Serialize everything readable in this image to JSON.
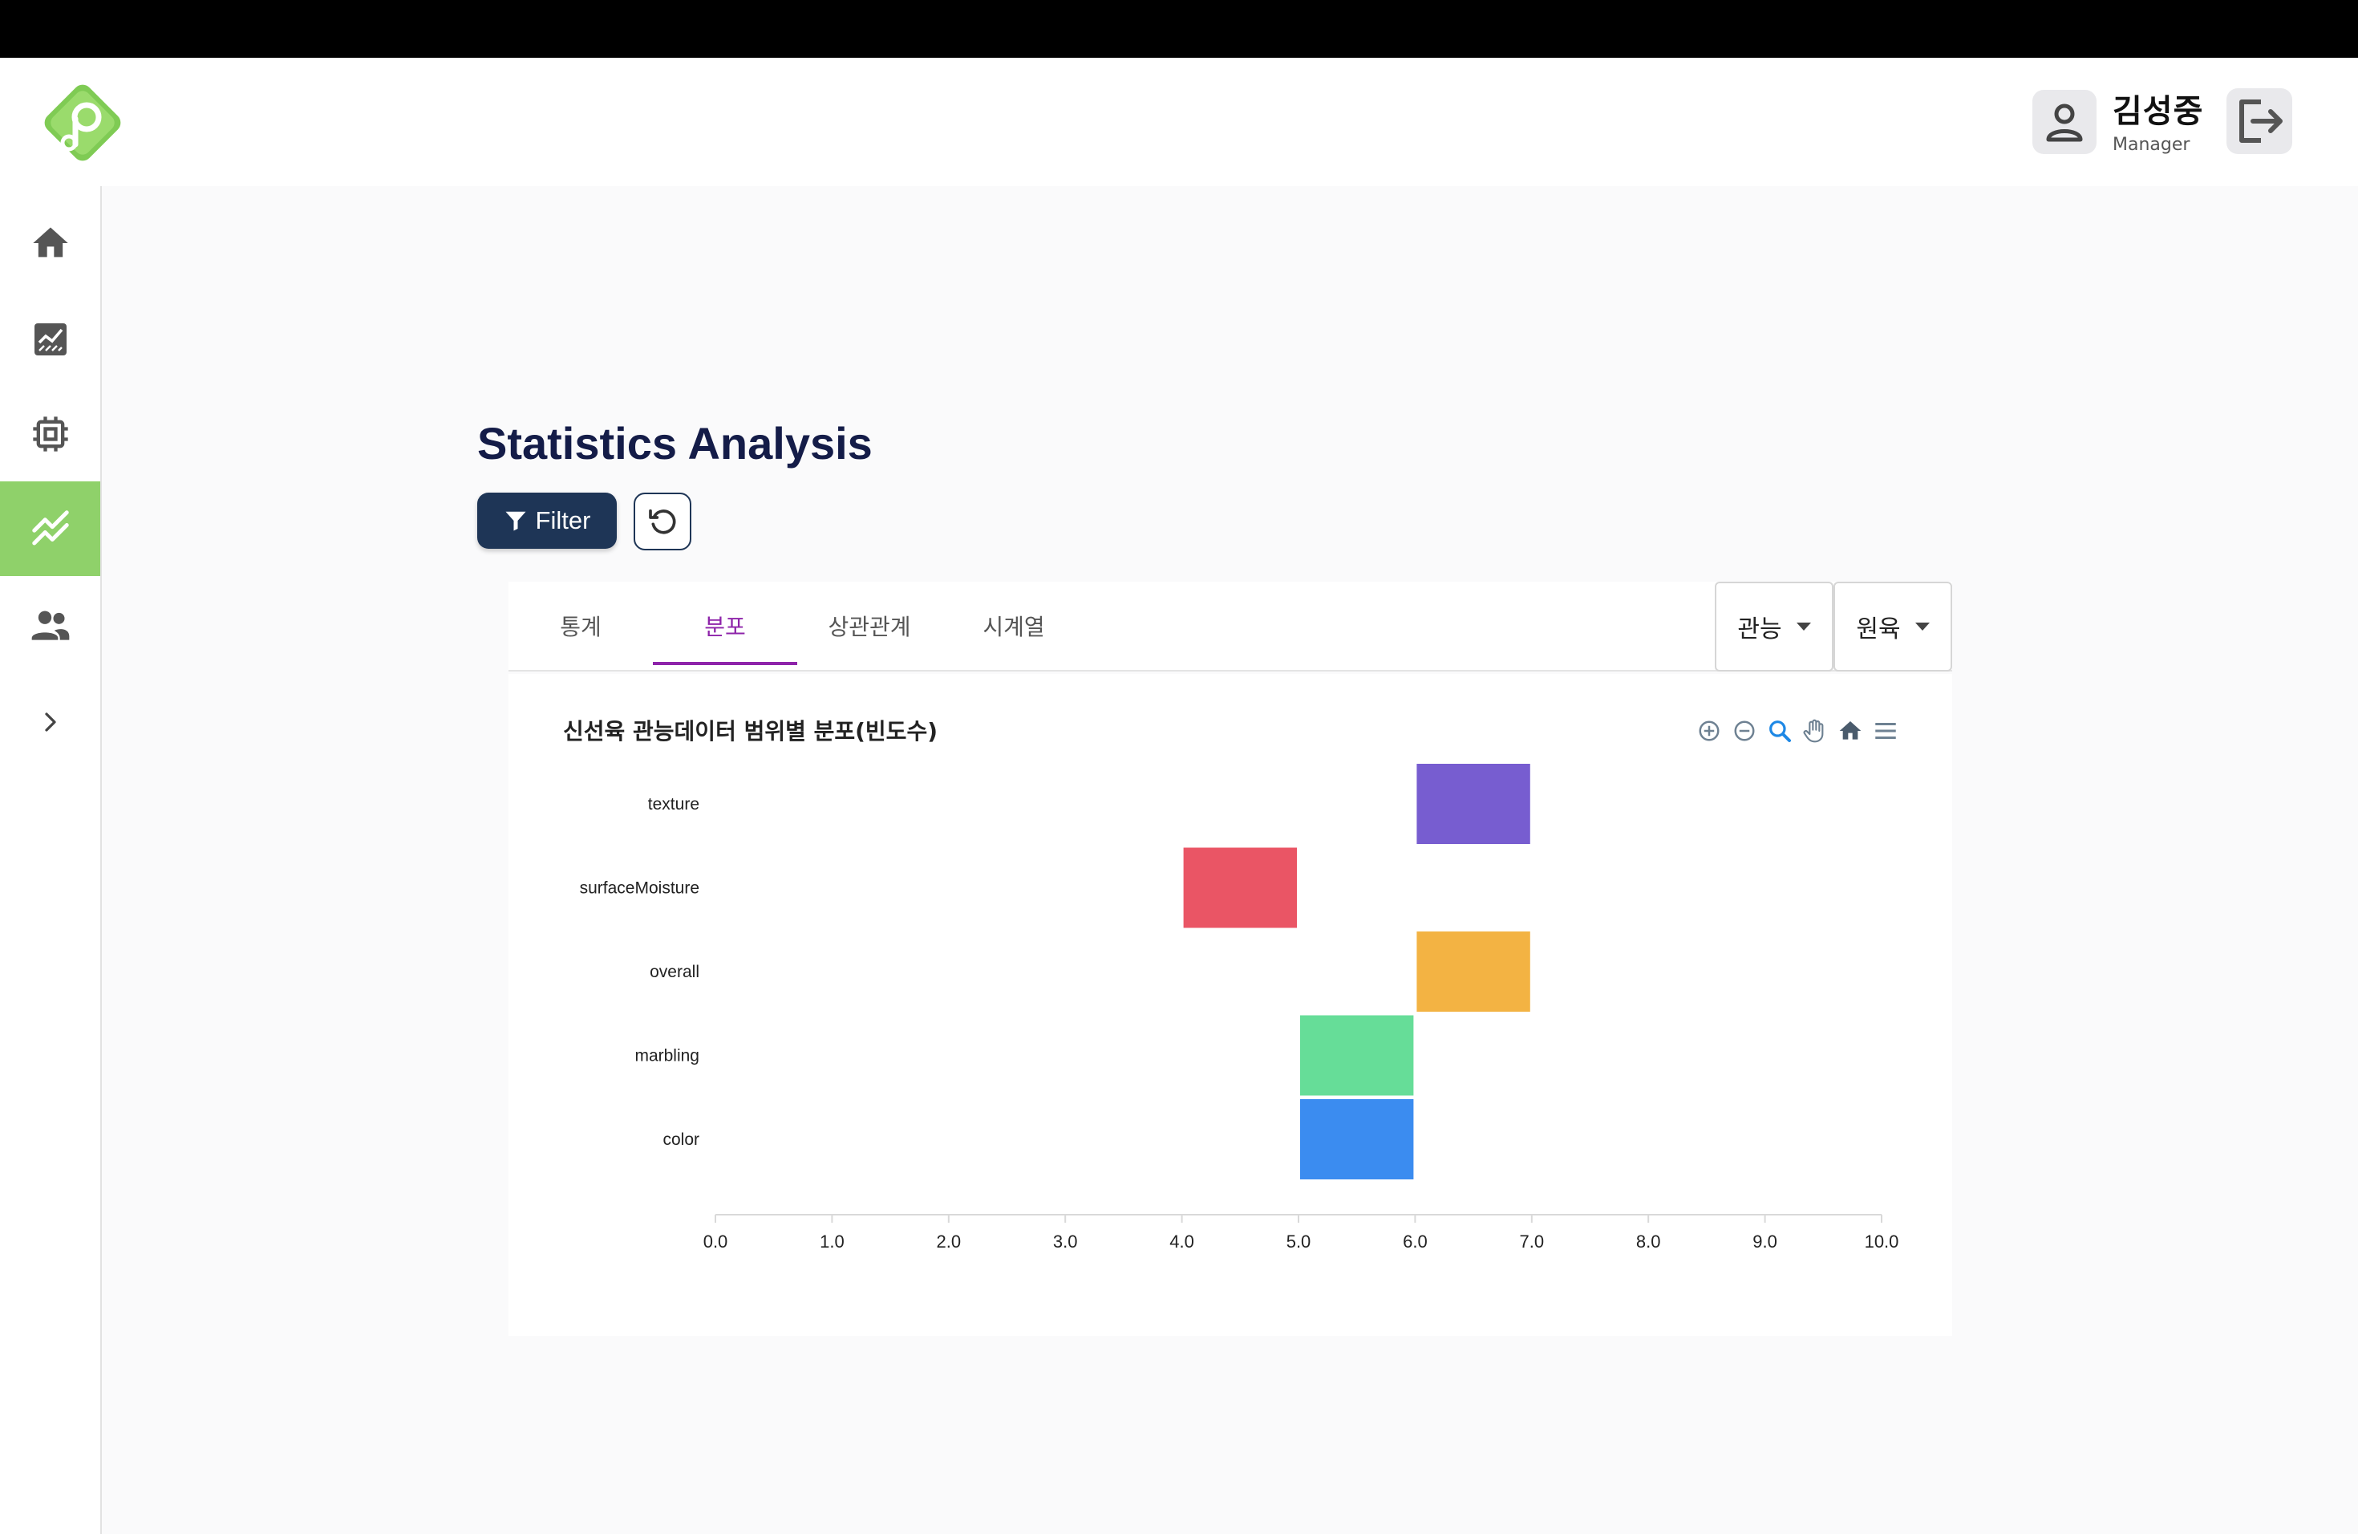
{
  "user": {
    "name": "김성중",
    "role": "Manager"
  },
  "page": {
    "title": "Statistics Analysis"
  },
  "actions": {
    "filter_label": "Filter"
  },
  "tabs": [
    {
      "label": "통계",
      "active": false
    },
    {
      "label": "분포",
      "active": true
    },
    {
      "label": "상관관계",
      "active": false
    },
    {
      "label": "시계열",
      "active": false
    }
  ],
  "selects": {
    "type_value": "관능",
    "meat_value": "원육"
  },
  "sidebar": {
    "items": [
      {
        "icon": "home-icon"
      },
      {
        "icon": "chart-area-icon"
      },
      {
        "icon": "chip-icon"
      },
      {
        "icon": "trend-icon",
        "active": true
      },
      {
        "icon": "people-icon"
      }
    ],
    "expand_icon": "chevron-right-icon"
  },
  "colors": {
    "accent": "#8fd16a",
    "brand_dark": "#1e3556",
    "tab_active": "#8e24aa"
  },
  "chart_data": {
    "type": "heatmap",
    "title": "신선육 관능데이터 범위별 분포(빈도수)",
    "categories": [
      "texture",
      "surfaceMoisture",
      "overall",
      "marbling",
      "color"
    ],
    "x_ticks": [
      "0.0",
      "1.0",
      "2.0",
      "3.0",
      "4.0",
      "5.0",
      "6.0",
      "7.0",
      "8.0",
      "9.0",
      "10.0"
    ],
    "xlim": [
      0,
      10
    ],
    "cells": [
      {
        "category": "texture",
        "range": [
          6,
          7
        ],
        "color": "#775dd0"
      },
      {
        "category": "surfaceMoisture",
        "range": [
          4,
          5
        ],
        "color": "#ea5565"
      },
      {
        "category": "overall",
        "range": [
          6,
          7
        ],
        "color": "#f3b343"
      },
      {
        "category": "marbling",
        "range": [
          5,
          6
        ],
        "color": "#66dd98"
      },
      {
        "category": "color",
        "range": [
          5,
          6
        ],
        "color": "#3b8cf0"
      }
    ],
    "grid": false
  }
}
